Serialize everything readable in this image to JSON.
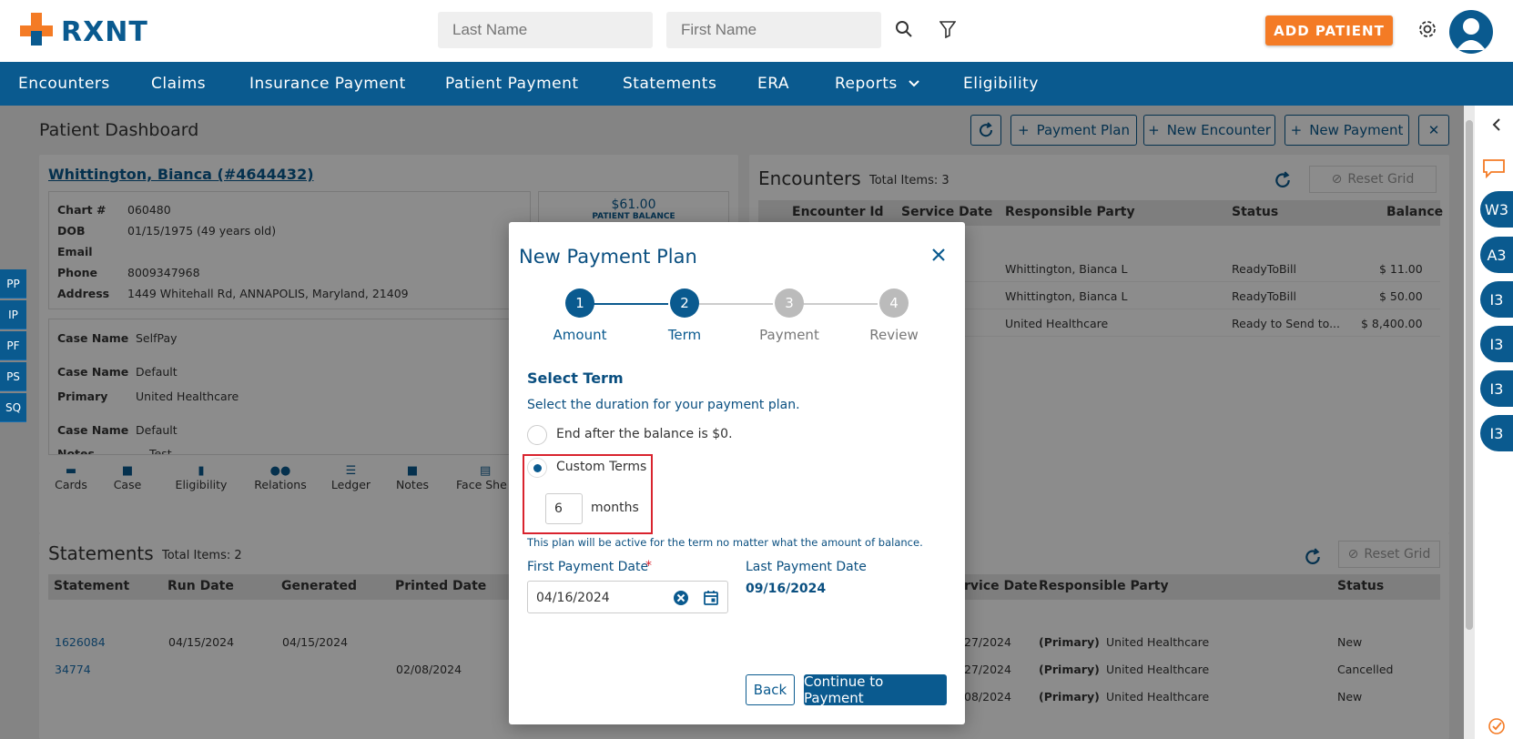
{
  "header": {
    "logo_text": "RXNT",
    "last_name_placeholder": "Last Name",
    "first_name_placeholder": "First Name",
    "add_patient_label": "ADD PATIENT"
  },
  "nav": {
    "items": [
      "Encounters",
      "Claims",
      "Insurance Payment",
      "Patient Payment",
      "Statements",
      "ERA",
      "Reports",
      "Eligibility"
    ]
  },
  "dashboard": {
    "title": "Patient Dashboard",
    "toolbar": {
      "payment_plan": "Payment Plan",
      "new_encounter": "New Encounter",
      "new_payment": "New Payment"
    },
    "patient": {
      "name": "Whittington, Bianca (#4644432)",
      "fields": [
        {
          "label": "Chart #",
          "value": "060480"
        },
        {
          "label": "DOB",
          "value": "01/15/1975 (49 years old)"
        },
        {
          "label": "Email",
          "value": ""
        },
        {
          "label": "Phone",
          "value": "8009347968"
        },
        {
          "label": "Address",
          "value": "1449 Whitehall Rd, ANNAPOLIS, Maryland, 21409"
        }
      ],
      "balance": "$61.00",
      "balance_label": "PATIENT BALANCE",
      "cases": [
        {
          "label": "Case Name",
          "value": "SelfPay"
        },
        {
          "label": "Case Name",
          "value": "Default"
        },
        {
          "label": "Primary",
          "value": "United Healthcare"
        },
        {
          "label": "Case Name",
          "value": "Default"
        },
        {
          "label": "Notes",
          "value": "Test"
        }
      ],
      "tabs": [
        "Cards",
        "Case",
        "Eligibility",
        "Relations",
        "Ledger",
        "Notes",
        "Face She"
      ]
    },
    "left_tabs": [
      "PP",
      "IP",
      "PF",
      "PS",
      "SQ"
    ],
    "encounters": {
      "title": "Encounters",
      "total": "Total Items: 3",
      "reset": "Reset Grid",
      "columns": [
        "Encounter Id",
        "Service Date",
        "Responsible Party",
        "Status",
        "Balance"
      ],
      "rows": [
        {
          "party": "Whittington, Bianca L",
          "status": "ReadyToBill",
          "balance": "$ 11.00"
        },
        {
          "party": "Whittington, Bianca L",
          "status": "ReadyToBill",
          "balance": "$ 50.00"
        },
        {
          "party": "United Healthcare",
          "status": "Ready to Send to...",
          "balance": "$ 8,400.00"
        }
      ]
    },
    "statements": {
      "title": "Statements",
      "total": "Total Items: 2",
      "columns": [
        "Statement",
        "Run Date",
        "Generated",
        "Printed Date"
      ],
      "rows": [
        {
          "id": "1626084",
          "run": "04/15/2024",
          "generated": "04/15/2024",
          "printed": ""
        },
        {
          "id": "34774",
          "run": "",
          "generated": "",
          "printed": "02/08/2024"
        }
      ]
    },
    "claims": {
      "reset": "Reset Grid",
      "columns": [
        "rvice Date",
        "Responsible Party",
        "Status"
      ],
      "rows": [
        {
          "date": "27/2024",
          "prefix": "(Primary)",
          "party": "United Healthcare",
          "status": "New"
        },
        {
          "date": "27/2024",
          "prefix": "(Primary)",
          "party": "United Healthcare",
          "status": "Cancelled"
        },
        {
          "date": "08/2024",
          "prefix": "(Primary)",
          "party": "United Healthcare",
          "status": "New"
        }
      ]
    }
  },
  "rail": {
    "items": [
      "W3",
      "A3",
      "I3",
      "I3",
      "I3",
      "I3"
    ]
  },
  "modal": {
    "title": "New Payment Plan",
    "steps": [
      {
        "num": "1",
        "label": "Amount"
      },
      {
        "num": "2",
        "label": "Term"
      },
      {
        "num": "3",
        "label": "Payment"
      },
      {
        "num": "4",
        "label": "Review"
      }
    ],
    "section_title": "Select Term",
    "section_desc": "Select the duration for your payment plan.",
    "option_balance": "End after the balance is $0.",
    "option_custom": "Custom Terms",
    "months_value": "6",
    "months_label": "months",
    "note": "This plan will be active for the term no matter what the amount of balance.",
    "first_date_label": "First Payment Date",
    "required_mark": "*",
    "first_date_value": "04/16/2024",
    "last_date_label": "Last Payment Date",
    "last_date_value": "09/16/2024",
    "back_label": "Back",
    "continue_label": "Continue to Payment"
  },
  "colors": {
    "primary": "#0a5a8f",
    "accent": "#f47b25",
    "highlight": "#d9232e"
  }
}
